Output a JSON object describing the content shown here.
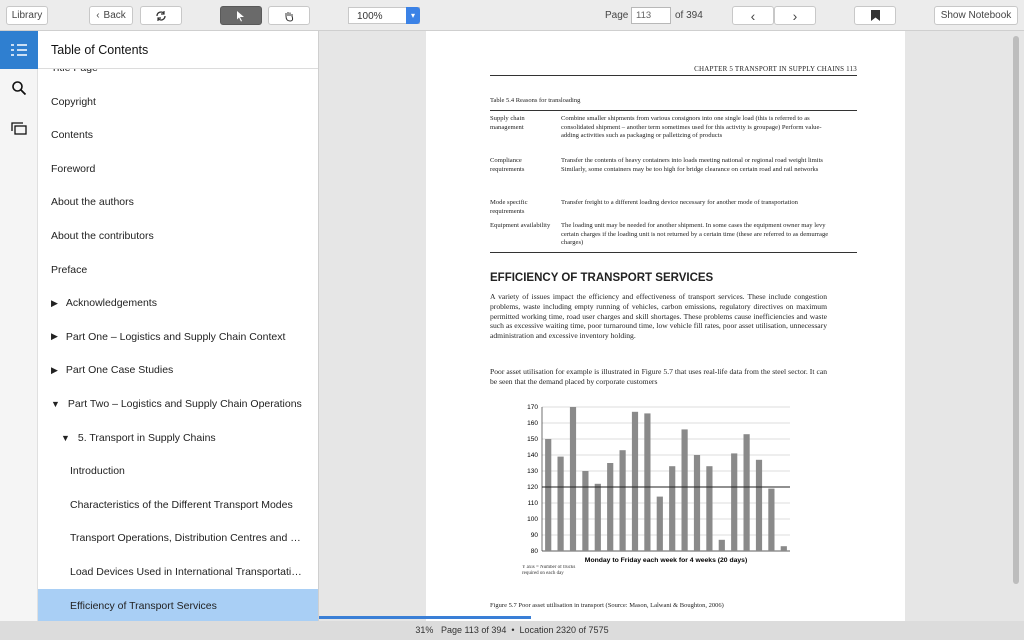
{
  "toolbar": {
    "library": "Library",
    "back": "Back",
    "zoom": "100%",
    "page_label": "Page",
    "page_value": "113",
    "page_total": "of 394",
    "show_notebook": "Show Notebook"
  },
  "toc": {
    "title": "Table of Contents",
    "clipped_item": "Title Page",
    "items": [
      {
        "label": "Copyright",
        "indent": 0,
        "arrow": ""
      },
      {
        "label": "Contents",
        "indent": 0,
        "arrow": ""
      },
      {
        "label": "Foreword",
        "indent": 0,
        "arrow": ""
      },
      {
        "label": "About the authors",
        "indent": 0,
        "arrow": ""
      },
      {
        "label": "About the contributors",
        "indent": 0,
        "arrow": ""
      },
      {
        "label": "Preface",
        "indent": 0,
        "arrow": ""
      },
      {
        "label": "Acknowledgements",
        "indent": 0,
        "arrow": "▶"
      },
      {
        "label": "Part One – Logistics and Supply Chain Context",
        "indent": 0,
        "arrow": "▶"
      },
      {
        "label": "Part One Case Studies",
        "indent": 0,
        "arrow": "▶"
      },
      {
        "label": "Part Two – Logistics and Supply Chain Operations",
        "indent": 0,
        "arrow": "▼"
      },
      {
        "label": "5. Transport in Supply Chains",
        "indent": 1,
        "arrow": "▼"
      },
      {
        "label": "Introduction",
        "indent": 2,
        "arrow": ""
      },
      {
        "label": "Characteristics of the Different Transport Modes",
        "indent": 2,
        "arrow": ""
      },
      {
        "label": "Transport Operations, Distribution Centres and …",
        "indent": 2,
        "arrow": ""
      },
      {
        "label": "Load Devices Used in International Transportati…",
        "indent": 2,
        "arrow": ""
      },
      {
        "label": "Efficiency of Transport Services",
        "indent": 2,
        "arrow": "",
        "selected": true
      }
    ]
  },
  "page": {
    "header": "CHAPTER 5   TRANSPORT IN SUPPLY CHAINS   113",
    "table_title": "Table 5.4   Reasons for transloading",
    "rows": [
      {
        "c1": "Supply chain management",
        "c2": "Combine smaller shipments from various consignors into one single load (this is referred to as consolidated shipment – another term sometimes used for this activity is groupage) Perform value-adding activities such as packaging or palletizing of products"
      },
      {
        "c1": "Compliance requirements",
        "c2": "Transfer the contents of heavy containers into loads meeting national or regional road weight limits Similarly, some containers may be too high for bridge clearance on certain road and rail networks"
      },
      {
        "c1": "Mode specific requirements",
        "c2": "Transfer freight to a different loading device necessary for another mode of transportation"
      },
      {
        "c1": "Equipment availability",
        "c2": "The loading unit may be needed for another shipment. In some cases the equipment owner may levy certain charges if the loading unit is not returned by a certain time (these are referred to as demurrage charges)"
      }
    ],
    "section_heading": "EFFICIENCY OF TRANSPORT SERVICES",
    "para1": "A variety of issues impact the efficiency and effectiveness of transport services. These include congestion problems, waste including empty running of vehicles, carbon emissions, regulatory directives on maximum permitted working time, road user charges and skill shortages. These problems cause inefficiencies and waste such as excessive waiting time, poor turnaround time, low vehicle fill rates, poor asset utilisation, unnecessary administration and excessive inventory holding.",
    "para2": "Poor asset utilisation for example is illustrated in Figure 5.7 that uses real-life data from the steel sector. It can be seen that the demand placed by corporate customers",
    "figure_caption": "Figure 5.7   Poor asset utilisation in transport (Source: Mason, Lalwani & Boughton, 2006)"
  },
  "chart_data": {
    "type": "bar",
    "xlabel": "Monday to Friday each week for 4 weeks (20 days)",
    "ylabel": "Y axis = Number of trucks required on each day",
    "ylim": [
      80,
      170
    ],
    "yticks": [
      80,
      90,
      100,
      110,
      120,
      130,
      140,
      150,
      160,
      170
    ],
    "reference_line": 120,
    "values": [
      150,
      139,
      170,
      130,
      122,
      135,
      143,
      167,
      166,
      114,
      133,
      156,
      140,
      133,
      87,
      141,
      153,
      137,
      119,
      83
    ]
  },
  "status": {
    "percent": "31%",
    "page_info": "Page 113 of 394",
    "location": "Location 2320 of 7575"
  },
  "colors": {
    "accent": "#3a7fd6",
    "selected": "#a9cff5"
  }
}
